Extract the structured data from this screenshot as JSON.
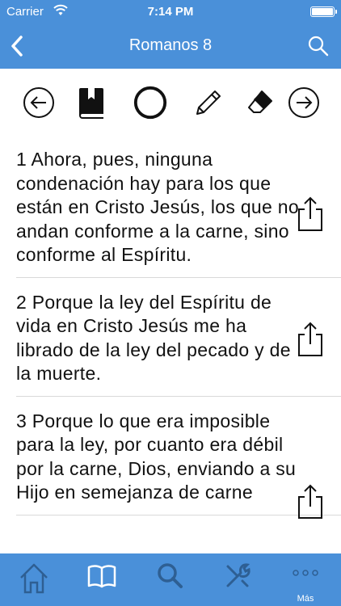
{
  "status": {
    "carrier": "Carrier",
    "time": "7:14 PM"
  },
  "nav": {
    "title": "Romanos 8"
  },
  "toolbar": {
    "tools": [
      "previous-chapter",
      "bookmark",
      "highlight",
      "note",
      "eraser",
      "next-chapter"
    ]
  },
  "verses": [
    {
      "text": "1  Ahora, pues, ninguna condenación hay para los que están en Cristo Jesús, los que no andan conforme a la carne, sino conforme al Espíritu."
    },
    {
      "text": "2 Porque la ley del Espíritu de vida en Cristo Jesús me ha librado de la ley del pecado y de la muerte."
    },
    {
      "text": "3 Porque lo que era imposible para la ley, por cuanto era débil por la carne, Dios, enviando a su Hijo en semejanza de carne"
    }
  ],
  "tabbar": {
    "more_label": "Más"
  },
  "colors": {
    "accent": "#4a90d9",
    "text": "#111111",
    "divider": "#d9d9d9"
  }
}
